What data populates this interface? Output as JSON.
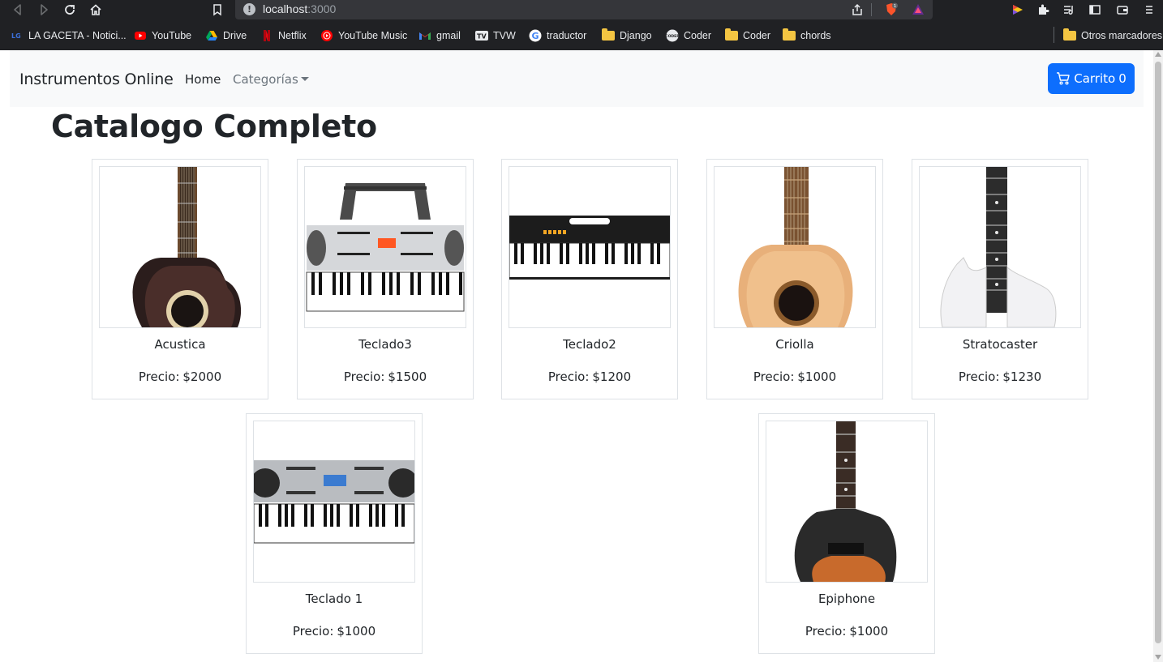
{
  "browser": {
    "url_host": "localhost",
    "url_port": ":3000",
    "brave_badge": "1",
    "bookmarks": [
      {
        "label": "LA GACETA - Notici...",
        "icon": "lagaceta-icon"
      },
      {
        "label": "YouTube",
        "icon": "youtube-icon"
      },
      {
        "label": "Drive",
        "icon": "drive-icon"
      },
      {
        "label": "Netflix",
        "icon": "netflix-icon"
      },
      {
        "label": "YouTube Music",
        "icon": "youtube-music-icon"
      },
      {
        "label": "gmail",
        "icon": "gmail-icon"
      },
      {
        "label": "TVW",
        "icon": "tvw-icon"
      },
      {
        "label": "traductor",
        "icon": "google-icon"
      },
      {
        "label": "Django",
        "icon": "folder-icon"
      },
      {
        "label": "Coder",
        "icon": "coder-icon"
      },
      {
        "label": "Coder",
        "icon": "folder-icon"
      },
      {
        "label": "chords",
        "icon": "folder-icon"
      }
    ],
    "other_bookmarks": "Otros marcadores"
  },
  "navbar": {
    "brand": "Instrumentos Online",
    "home": "Home",
    "categories": "Categorías",
    "cart_label": "Carrito",
    "cart_count": "0"
  },
  "main": {
    "title": "Catalogo Completo",
    "price_label": "Precio:",
    "products": [
      {
        "name": "Acustica",
        "price": "$2000",
        "image": "acoustic-guitar-image"
      },
      {
        "name": "Teclado3",
        "price": "$1500",
        "image": "keyboard-image"
      },
      {
        "name": "Teclado2",
        "price": "$1200",
        "image": "keyboard-image"
      },
      {
        "name": "Criolla",
        "price": "$1000",
        "image": "classical-guitar-image"
      },
      {
        "name": "Stratocaster",
        "price": "$1230",
        "image": "electric-guitar-image"
      },
      {
        "name": "Teclado 1",
        "price": "$1000",
        "image": "keyboard-image"
      },
      {
        "name": "Epiphone",
        "price": "$1000",
        "image": "electric-guitar-image"
      }
    ]
  },
  "colors": {
    "primary": "#0d6efd",
    "navbar_bg": "#f8f9fa",
    "chrome_bg": "#202124"
  }
}
